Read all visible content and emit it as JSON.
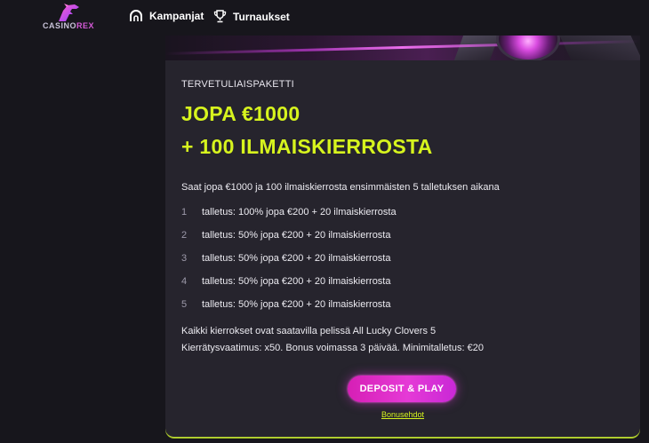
{
  "brand": {
    "logo_casino": "CASINO",
    "logo_rex": "REX",
    "icon": "dinosaur-logo-icon"
  },
  "nav": {
    "items": [
      {
        "label": "Kampanjat",
        "icon": "promotion-icon"
      },
      {
        "label": "Turnaukset",
        "icon": "trophy-icon"
      }
    ]
  },
  "offer": {
    "eyebrow": "TERVETULIAISPAKETTI",
    "headline_1": "JOPA €1000",
    "headline_2": "+ 100 ILMAISKIERROSTA",
    "intro": "Saat jopa €1000 ja 100 ilmaiskierrosta ensimmäisten 5 talletuksen aikana",
    "steps": [
      {
        "num": "1",
        "text": "talletus: 100% jopa €200 + 20 ilmaiskierrosta"
      },
      {
        "num": "2",
        "text": "talletus: 50% jopa €200 + 20 ilmaiskierrosta"
      },
      {
        "num": "3",
        "text": "talletus: 50% jopa €200 + 20 ilmaiskierrosta"
      },
      {
        "num": "4",
        "text": "talletus: 50% jopa €200 + 20 ilmaiskierrosta"
      },
      {
        "num": "5",
        "text": "talletus: 50% jopa €200 + 20 ilmaiskierrosta"
      }
    ],
    "footnote_1": "Kaikki kierrokset ovat saatavilla pelissä All Lucky Clovers 5",
    "footnote_2": "Kierrätysvaatimus: x50. Bonus voimassa 3 päivää. Minimitalletus: €20",
    "cta_label": "DEPOSIT & PLAY",
    "terms_label": "Bonusehdot"
  },
  "colors": {
    "background": "#17161c",
    "card": "#26242d",
    "accent_lime": "#d7f41e",
    "accent_magenta": "#e53ad6"
  }
}
